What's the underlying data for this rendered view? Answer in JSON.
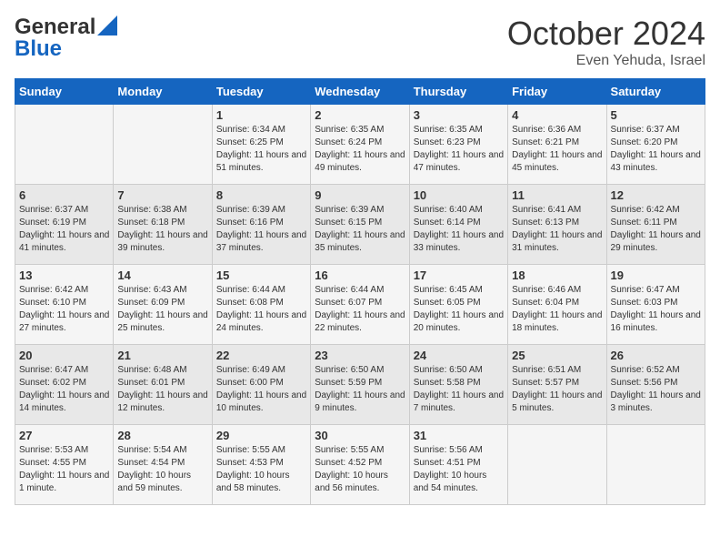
{
  "header": {
    "logo_line1": "General",
    "logo_line2": "Blue",
    "month": "October 2024",
    "location": "Even Yehuda, Israel"
  },
  "days_of_week": [
    "Sunday",
    "Monday",
    "Tuesday",
    "Wednesday",
    "Thursday",
    "Friday",
    "Saturday"
  ],
  "weeks": [
    [
      {
        "day": "",
        "info": ""
      },
      {
        "day": "",
        "info": ""
      },
      {
        "day": "1",
        "info": "Sunrise: 6:34 AM\nSunset: 6:25 PM\nDaylight: 11 hours and 51 minutes."
      },
      {
        "day": "2",
        "info": "Sunrise: 6:35 AM\nSunset: 6:24 PM\nDaylight: 11 hours and 49 minutes."
      },
      {
        "day": "3",
        "info": "Sunrise: 6:35 AM\nSunset: 6:23 PM\nDaylight: 11 hours and 47 minutes."
      },
      {
        "day": "4",
        "info": "Sunrise: 6:36 AM\nSunset: 6:21 PM\nDaylight: 11 hours and 45 minutes."
      },
      {
        "day": "5",
        "info": "Sunrise: 6:37 AM\nSunset: 6:20 PM\nDaylight: 11 hours and 43 minutes."
      }
    ],
    [
      {
        "day": "6",
        "info": "Sunrise: 6:37 AM\nSunset: 6:19 PM\nDaylight: 11 hours and 41 minutes."
      },
      {
        "day": "7",
        "info": "Sunrise: 6:38 AM\nSunset: 6:18 PM\nDaylight: 11 hours and 39 minutes."
      },
      {
        "day": "8",
        "info": "Sunrise: 6:39 AM\nSunset: 6:16 PM\nDaylight: 11 hours and 37 minutes."
      },
      {
        "day": "9",
        "info": "Sunrise: 6:39 AM\nSunset: 6:15 PM\nDaylight: 11 hours and 35 minutes."
      },
      {
        "day": "10",
        "info": "Sunrise: 6:40 AM\nSunset: 6:14 PM\nDaylight: 11 hours and 33 minutes."
      },
      {
        "day": "11",
        "info": "Sunrise: 6:41 AM\nSunset: 6:13 PM\nDaylight: 11 hours and 31 minutes."
      },
      {
        "day": "12",
        "info": "Sunrise: 6:42 AM\nSunset: 6:11 PM\nDaylight: 11 hours and 29 minutes."
      }
    ],
    [
      {
        "day": "13",
        "info": "Sunrise: 6:42 AM\nSunset: 6:10 PM\nDaylight: 11 hours and 27 minutes."
      },
      {
        "day": "14",
        "info": "Sunrise: 6:43 AM\nSunset: 6:09 PM\nDaylight: 11 hours and 25 minutes."
      },
      {
        "day": "15",
        "info": "Sunrise: 6:44 AM\nSunset: 6:08 PM\nDaylight: 11 hours and 24 minutes."
      },
      {
        "day": "16",
        "info": "Sunrise: 6:44 AM\nSunset: 6:07 PM\nDaylight: 11 hours and 22 minutes."
      },
      {
        "day": "17",
        "info": "Sunrise: 6:45 AM\nSunset: 6:05 PM\nDaylight: 11 hours and 20 minutes."
      },
      {
        "day": "18",
        "info": "Sunrise: 6:46 AM\nSunset: 6:04 PM\nDaylight: 11 hours and 18 minutes."
      },
      {
        "day": "19",
        "info": "Sunrise: 6:47 AM\nSunset: 6:03 PM\nDaylight: 11 hours and 16 minutes."
      }
    ],
    [
      {
        "day": "20",
        "info": "Sunrise: 6:47 AM\nSunset: 6:02 PM\nDaylight: 11 hours and 14 minutes."
      },
      {
        "day": "21",
        "info": "Sunrise: 6:48 AM\nSunset: 6:01 PM\nDaylight: 11 hours and 12 minutes."
      },
      {
        "day": "22",
        "info": "Sunrise: 6:49 AM\nSunset: 6:00 PM\nDaylight: 11 hours and 10 minutes."
      },
      {
        "day": "23",
        "info": "Sunrise: 6:50 AM\nSunset: 5:59 PM\nDaylight: 11 hours and 9 minutes."
      },
      {
        "day": "24",
        "info": "Sunrise: 6:50 AM\nSunset: 5:58 PM\nDaylight: 11 hours and 7 minutes."
      },
      {
        "day": "25",
        "info": "Sunrise: 6:51 AM\nSunset: 5:57 PM\nDaylight: 11 hours and 5 minutes."
      },
      {
        "day": "26",
        "info": "Sunrise: 6:52 AM\nSunset: 5:56 PM\nDaylight: 11 hours and 3 minutes."
      }
    ],
    [
      {
        "day": "27",
        "info": "Sunrise: 5:53 AM\nSunset: 4:55 PM\nDaylight: 11 hours and 1 minute."
      },
      {
        "day": "28",
        "info": "Sunrise: 5:54 AM\nSunset: 4:54 PM\nDaylight: 10 hours and 59 minutes."
      },
      {
        "day": "29",
        "info": "Sunrise: 5:55 AM\nSunset: 4:53 PM\nDaylight: 10 hours and 58 minutes."
      },
      {
        "day": "30",
        "info": "Sunrise: 5:55 AM\nSunset: 4:52 PM\nDaylight: 10 hours and 56 minutes."
      },
      {
        "day": "31",
        "info": "Sunrise: 5:56 AM\nSunset: 4:51 PM\nDaylight: 10 hours and 54 minutes."
      },
      {
        "day": "",
        "info": ""
      },
      {
        "day": "",
        "info": ""
      }
    ]
  ]
}
